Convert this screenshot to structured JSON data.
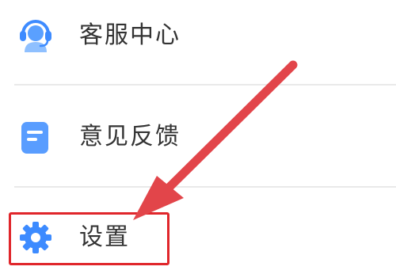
{
  "menu": {
    "items": [
      {
        "label": "客服中心",
        "icon": "headset-support-icon"
      },
      {
        "label": "意见反馈",
        "icon": "feedback-document-icon"
      },
      {
        "label": "设置",
        "icon": "gear-icon"
      }
    ]
  },
  "colors": {
    "icon_blue": "#3d8bff",
    "icon_blue_light": "#8fc0ff",
    "highlight_red": "#e0262b",
    "arrow_red": "#e2454a",
    "divider": "#e9e9e9",
    "text": "#333333"
  }
}
